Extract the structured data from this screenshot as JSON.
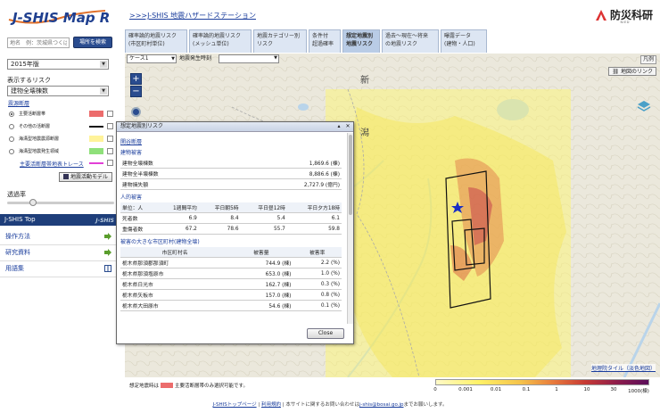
{
  "header": {
    "logo_text": "J-SHIS Map R",
    "site_link": ">>>J-SHIS 地震ハザードステーション",
    "org_name": "防災科研",
    "org_sub": "NIED"
  },
  "left": {
    "search_placeholder": "地名　例：茨城県つくば市",
    "search_button": "場所を検索",
    "year_value": "2015年版",
    "risk_label": "表示するリスク",
    "risk_value": "建物全壊棟数",
    "fault_link": "震源断層",
    "layers": [
      {
        "name": "主要活断層帯",
        "color": "#ec6c6c",
        "selected": true
      },
      {
        "name": "その他の活断層",
        "color": "#111111",
        "selected": false
      },
      {
        "name": "海溝型地震震源断層",
        "color": "#fff39a",
        "selected": false
      },
      {
        "name": "海溝型地震発生領域",
        "color": "#8fe07a",
        "selected": false
      }
    ],
    "trace_link": "主要活断層帯地表トレース",
    "trace_color": "#e23fd6",
    "quake_model_button": "地震活動モデル",
    "opacity_label": "透過率",
    "opacity_value": 0.22
  },
  "menu": {
    "top_bar": "J-SHIS Top",
    "top_brand": "J-SHIS",
    "items": [
      "操作方法",
      "研究資料",
      "用語集"
    ]
  },
  "tabs": [
    "確率論的地震リスク\n(市区町村単位)",
    "確率論的地震リスク\n(メッシュ単位)",
    "地震カテゴリー別\nリスク",
    "条件付\n超過確率",
    "想定地震別\n地震リスク",
    "過去〜現在〜将来\nの地震リスク",
    "曝露データ\n(建物・人口)"
  ],
  "map": {
    "case_value": "ケース1",
    "time_label": "地震発生時刻",
    "legend_button": "凡例",
    "map_link": "地図のリンク",
    "tile_credit": "地理院タイル（淡色地図）",
    "place_names": [
      "新",
      "潟"
    ]
  },
  "popup": {
    "title": "想定地震別リスク",
    "section_link": "関谷断層",
    "building_header": "建物被害",
    "building_rows": [
      {
        "label": "建物全壊棟数",
        "value": "1,869.6 (棟)"
      },
      {
        "label": "建物全半壊棟数",
        "value": "8,886.6 (棟)"
      },
      {
        "label": "建物損失額",
        "value": "2,727.9 (億円)"
      }
    ],
    "human_header": "人的被害",
    "human_columns": [
      "単位：人",
      "1週間平均",
      "平日朝5時",
      "平日昼12時",
      "平日夕方18時"
    ],
    "human_rows": [
      {
        "label": "死者数",
        "values": [
          "6.9",
          "8.4",
          "5.4",
          "6.1"
        ]
      },
      {
        "label": "重傷者数",
        "values": [
          "67.2",
          "78.6",
          "55.7",
          "59.8"
        ]
      }
    ],
    "city_header": "被害の大きな市区町村(建物全壊)",
    "city_columns": [
      "市区町村名",
      "被害量",
      "被害率"
    ],
    "city_rows": [
      {
        "name": "栃木県那須郡那須町",
        "amount": "744.9 (棟)",
        "rate": "2.2 (%)"
      },
      {
        "name": "栃木県那須塩原市",
        "amount": "653.0 (棟)",
        "rate": "1.0 (%)"
      },
      {
        "name": "栃木県日光市",
        "amount": "162.7 (棟)",
        "rate": "0.3 (%)"
      },
      {
        "name": "栃木県矢板市",
        "amount": "157.0 (棟)",
        "rate": "0.8 (%)"
      },
      {
        "name": "栃木県大田原市",
        "amount": "54.6 (棟)",
        "rate": "0.1 (%)"
      }
    ],
    "close_button": "Close"
  },
  "legend": {
    "note": "想定地震時は主要活断層帯のみ選択可能です。",
    "note_prefix": "想定地震時は",
    "note_suffix": "主要活断層帯のみ選択可能です。",
    "ticks": [
      "0",
      "0.001",
      "0.01",
      "0.1",
      "1",
      "10",
      "30",
      "1000(棟)"
    ]
  },
  "footer": {
    "link1": "J-SHISトップページ",
    "link2": "利用規約",
    "text": "本サイトに関するお問い合わせは",
    "email": "j-shis@bosai.go.jp",
    "text2": "までお願いします。"
  }
}
